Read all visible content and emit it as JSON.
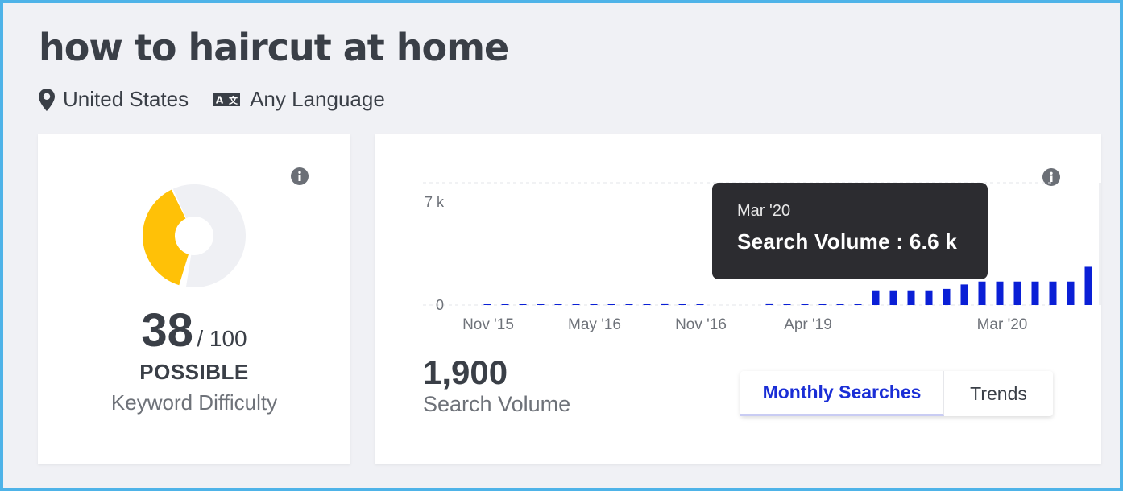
{
  "header": {
    "title": "how to haircut at home",
    "location": "United States",
    "language": "Any Language"
  },
  "difficulty": {
    "score": "38",
    "max": "/ 100",
    "level": "POSSIBLE",
    "label": "Keyword Difficulty",
    "fraction": 0.38,
    "color": "#ffc107",
    "track_color": "#eff0f4"
  },
  "volume": {
    "value": "1,900",
    "label": "Search Volume",
    "tabs": [
      "Monthly Searches",
      "Trends"
    ],
    "active_tab": "Monthly Searches"
  },
  "tooltip": {
    "date": "Mar '20",
    "text": "Search Volume : 6.6 k"
  },
  "colors": {
    "bar": "#0a1fd6",
    "accent_text": "#1a2ed6",
    "tooltip_bg": "#2c2c30",
    "frame": "#4eb3e8"
  },
  "chart_data": {
    "type": "bar",
    "x_tick_labels": [
      "Nov '15",
      "May '16",
      "Nov '16",
      "Apr '19",
      "Mar '20"
    ],
    "y_tick_labels": [
      "0",
      "7 k"
    ],
    "ylim": [
      0,
      7000
    ],
    "series": [
      {
        "values": [
          20,
          20,
          20,
          20,
          20,
          20,
          20,
          20,
          20,
          20,
          60,
          20,
          20,
          60,
          20,
          20,
          20,
          20,
          20,
          1000,
          1000,
          1000,
          1000,
          1100,
          1400,
          1600,
          1600,
          1600,
          1600,
          1600,
          1600,
          2600,
          6600
        ]
      }
    ],
    "highlighted_index": 32,
    "grid": true
  }
}
